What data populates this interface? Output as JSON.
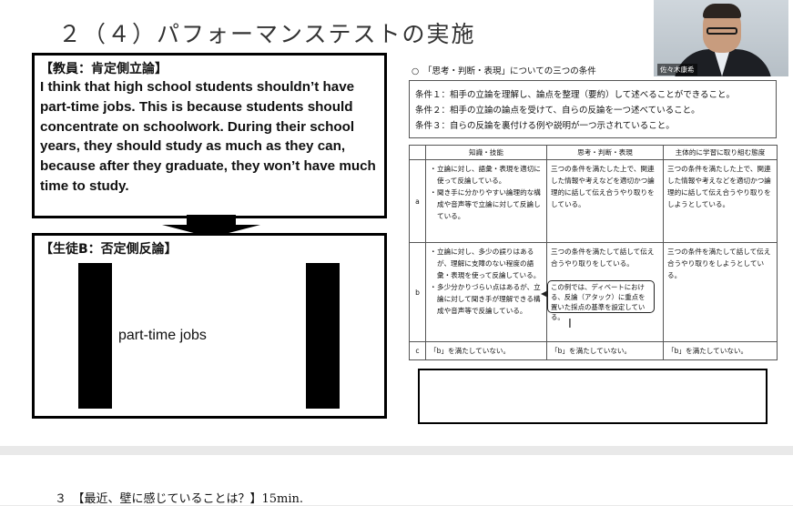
{
  "slide": {
    "title": "２（４）パフォーマンステストの実施",
    "teacher_box": {
      "heading": "【教員：肯定側立論】",
      "text": "I think that high school students shouldn’t have part-time jobs. This is because students should concentrate on schoolwork. During their school years, they should study as much as they can, because after they graduate, they won’t have much time to study."
    },
    "student_box": {
      "heading": "【生徒B：否定側反論】",
      "content": "part-time jobs"
    },
    "conditions": {
      "title": "○　「思考・判断・表現」についての三つの条件",
      "items": [
        "条件１：相手の立論を理解し、論点を整理（要約）して述べることができること。",
        "条件２：相手の立論の論点を受けて、自らの反論を一つ述べていること。",
        "条件３：自らの反論を裏付ける例や説明が一つ示されていること。"
      ]
    },
    "rubric": {
      "headers": [
        "",
        "知識・技能",
        "思考・判断・表現",
        "主体的に学習に取り組む態度"
      ],
      "rows": [
        {
          "level": "a",
          "knowledge": [
            "立論に対し、語彙・表現を適切に使って反論している。",
            "聞き手に分かりやすい論理的な構成や音声等で立論に対して反論している。"
          ],
          "thinking": "三つの条件を満たした上で、関連した情報や考えなどを適切かつ論理的に話して伝え合うやり取りをしている。",
          "attitude": "三つの条件を満たした上で、関連した情報や考えなどを適切かつ論理的に話して伝え合うやり取りをしようとしている。"
        },
        {
          "level": "b",
          "knowledge": [
            "立論に対し、多少の誤りはあるが、理解に支障のない程度の語彙・表現を使って反論している。",
            "多少分かりづらい点はあるが、立論に対して聞き手が理解できる構成や音声等で反論している。"
          ],
          "thinking": "三つの条件を満たして話して伝え合うやり取りをしている。",
          "attitude": "三つの条件を満たして話して伝え合うやり取りをしようとしている。"
        },
        {
          "level": "c",
          "knowledge": [
            "「b」を満たしていない。"
          ],
          "thinking": "「b」を満たしていない。",
          "attitude": "「b」を満たしていない。"
        }
      ],
      "callout": "この例では、ディベートにおける、反論（アタック）に重点を置いた採点の基準を設定している。"
    }
  },
  "webcam": {
    "name": "佐々木康希"
  },
  "next_slide": {
    "title": "３　【最近、壁に感じていることは？】15min."
  }
}
